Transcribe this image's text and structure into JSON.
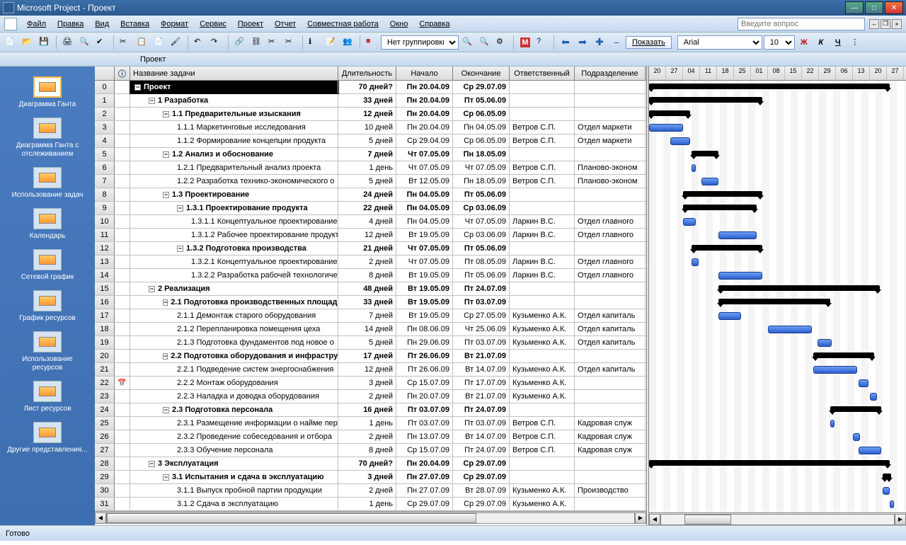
{
  "title": "Microsoft Project - Проект",
  "ask_placeholder": "Введите вопрос",
  "menu": [
    "Файл",
    "Правка",
    "Вид",
    "Вставка",
    "Формат",
    "Сервис",
    "Проект",
    "Отчет",
    "Совместная работа",
    "Окно",
    "Справка"
  ],
  "toolbar": {
    "grouping": "Нет группировки",
    "show_label": "Показать",
    "font": "Arial",
    "size": "10"
  },
  "doc_label": "Проект",
  "sidebar": [
    {
      "label": "Диаграмма Ганта",
      "active": true
    },
    {
      "label": "Диаграмма Ганта с отслеживанием"
    },
    {
      "label": "Использование задач"
    },
    {
      "label": "Календарь"
    },
    {
      "label": "Сетевой график"
    },
    {
      "label": "График ресурсов"
    },
    {
      "label": "Использование ресурсов"
    },
    {
      "label": "Лист ресурсов"
    },
    {
      "label": "Другие представления..."
    }
  ],
  "columns": {
    "info": "ⓘ",
    "name": "Название задачи",
    "dur": "Длительность",
    "start": "Начало",
    "end": "Окончание",
    "resp": "Ответственный",
    "dept": "Подразделение"
  },
  "timeline_days": [
    "20",
    "27",
    "04",
    "11",
    "18",
    "25",
    "01",
    "08",
    "15",
    "22",
    "29",
    "06",
    "13",
    "20",
    "27"
  ],
  "tasks": [
    {
      "row": 0,
      "lvl": 0,
      "exp": "-",
      "name": "Проект",
      "dur": "70 дней?",
      "start": "Пн 20.04.09",
      "end": "Ср 29.07.09",
      "resp": "",
      "dept": "",
      "sum": true,
      "gx": 0,
      "gw": 340,
      "selected": true
    },
    {
      "row": 1,
      "lvl": 1,
      "exp": "-",
      "name": "1 Разработка",
      "dur": "33 дней",
      "start": "Пн 20.04.09",
      "end": "Пт 05.06.09",
      "resp": "",
      "dept": "",
      "sum": true,
      "gx": 0,
      "gw": 160
    },
    {
      "row": 2,
      "lvl": 2,
      "exp": "-",
      "name": "1.1 Предварительные изыскания",
      "dur": "12 дней",
      "start": "Пн 20.04.09",
      "end": "Ср 06.05.09",
      "resp": "",
      "dept": "",
      "sum": true,
      "gx": 0,
      "gw": 58
    },
    {
      "row": 3,
      "lvl": 3,
      "leaf": true,
      "name": "1.1.1 Маркетинговые исследования",
      "dur": "10 дней",
      "start": "Пн 20.04.09",
      "end": "Пн 04.05.09",
      "resp": "Ветров С.П.",
      "dept": "Отдел маркети",
      "gx": 0,
      "gw": 48
    },
    {
      "row": 4,
      "lvl": 3,
      "leaf": true,
      "name": "1.1.2 Формирование концепции продукта",
      "dur": "5 дней",
      "start": "Ср 29.04.09",
      "end": "Ср 06.05.09",
      "resp": "Ветров С.П.",
      "dept": "Отдел маркети",
      "gx": 30,
      "gw": 28
    },
    {
      "row": 5,
      "lvl": 2,
      "exp": "-",
      "name": "1.2 Анализ и обоснование",
      "dur": "7 дней",
      "start": "Чт 07.05.09",
      "end": "Пн 18.05.09",
      "resp": "",
      "dept": "",
      "sum": true,
      "gx": 60,
      "gw": 38
    },
    {
      "row": 6,
      "lvl": 3,
      "leaf": true,
      "name": "1.2.1 Предварительный анализ проекта",
      "dur": "1 день",
      "start": "Чт 07.05.09",
      "end": "Чт 07.05.09",
      "resp": "Ветров С.П.",
      "dept": "Планово-эконом",
      "gx": 60,
      "gw": 6
    },
    {
      "row": 7,
      "lvl": 3,
      "leaf": true,
      "name": "1.2.2 Разработка технико-экономического о",
      "dur": "5 дней",
      "start": "Вт 12.05.09",
      "end": "Пн 18.05.09",
      "resp": "Ветров С.П.",
      "dept": "Планово-эконом",
      "gx": 74,
      "gw": 24
    },
    {
      "row": 8,
      "lvl": 2,
      "exp": "-",
      "name": "1.3 Проектирование",
      "dur": "24 дней",
      "start": "Пн 04.05.09",
      "end": "Пт 05.06.09",
      "resp": "",
      "dept": "",
      "sum": true,
      "gx": 48,
      "gw": 112
    },
    {
      "row": 9,
      "lvl": 3,
      "exp": "-",
      "name": "1.3.1 Проектирование продукта",
      "dur": "22 дней",
      "start": "Пн 04.05.09",
      "end": "Ср 03.06.09",
      "resp": "",
      "dept": "",
      "sum": true,
      "gx": 48,
      "gw": 104
    },
    {
      "row": 10,
      "lvl": 4,
      "leaf": true,
      "name": "1.3.1.1 Концептуальное проектирование",
      "dur": "4 дней",
      "start": "Пн 04.05.09",
      "end": "Чт 07.05.09",
      "resp": "Ларкин В.С.",
      "dept": "Отдел главного",
      "gx": 48,
      "gw": 18
    },
    {
      "row": 11,
      "lvl": 4,
      "leaf": true,
      "name": "1.3.1.2 Рабочее проектирование продукт",
      "dur": "12 дней",
      "start": "Вт 19.05.09",
      "end": "Ср 03.06.09",
      "resp": "Ларкин В.С.",
      "dept": "Отдел главного",
      "gx": 98,
      "gw": 54
    },
    {
      "row": 12,
      "lvl": 3,
      "exp": "-",
      "name": "1.3.2 Подготовка производства",
      "dur": "21 дней",
      "start": "Чт 07.05.09",
      "end": "Пт 05.06.09",
      "resp": "",
      "dept": "",
      "sum": true,
      "gx": 60,
      "gw": 100
    },
    {
      "row": 13,
      "lvl": 4,
      "leaf": true,
      "name": "1.3.2.1 Концептуальное проектирование",
      "dur": "2 дней",
      "start": "Чт 07.05.09",
      "end": "Пт 08.05.09",
      "resp": "Ларкин В.С.",
      "dept": "Отдел главного",
      "gx": 60,
      "gw": 10
    },
    {
      "row": 14,
      "lvl": 4,
      "leaf": true,
      "name": "1.3.2.2 Разработка рабочей технологиче",
      "dur": "8 дней",
      "start": "Вт 19.05.09",
      "end": "Пт 05.06.09",
      "resp": "Ларкин В.С.",
      "dept": "Отдел главного",
      "gx": 98,
      "gw": 62
    },
    {
      "row": 15,
      "lvl": 1,
      "exp": "-",
      "name": "2 Реализация",
      "dur": "48 дней",
      "start": "Вт 19.05.09",
      "end": "Пт 24.07.09",
      "resp": "",
      "dept": "",
      "sum": true,
      "gx": 98,
      "gw": 228
    },
    {
      "row": 16,
      "lvl": 2,
      "exp": "-",
      "name": "2.1 Подготовка производственных площад",
      "dur": "33 дней",
      "start": "Вт 19.05.09",
      "end": "Пт 03.07.09",
      "resp": "",
      "dept": "",
      "sum": true,
      "gx": 98,
      "gw": 158
    },
    {
      "row": 17,
      "lvl": 3,
      "leaf": true,
      "name": "2.1.1 Демонтаж старого оборудования",
      "dur": "7 дней",
      "start": "Вт 19.05.09",
      "end": "Ср 27.05.09",
      "resp": "Кузьменко А.К.",
      "dept": "Отдел капиталь",
      "gx": 98,
      "gw": 32
    },
    {
      "row": 18,
      "lvl": 3,
      "leaf": true,
      "name": "2.1.2 Перепланировка помещения цеха",
      "dur": "14 дней",
      "start": "Пн 08.06.09",
      "end": "Чт 25.06.09",
      "resp": "Кузьменко А.К.",
      "dept": "Отдел капиталь",
      "gx": 168,
      "gw": 62
    },
    {
      "row": 19,
      "lvl": 3,
      "leaf": true,
      "name": "2.1.3 Подготовка фундаментов под новое о",
      "dur": "5 дней",
      "start": "Пн 29.06.09",
      "end": "Пт 03.07.09",
      "resp": "Кузьменко А.К.",
      "dept": "Отдел капиталь",
      "gx": 238,
      "gw": 20
    },
    {
      "row": 20,
      "lvl": 2,
      "exp": "-",
      "name": "2.2 Подготовка оборудования и инфрастру",
      "dur": "17 дней",
      "start": "Пт 26.06.09",
      "end": "Вт 21.07.09",
      "resp": "",
      "dept": "",
      "sum": true,
      "gx": 232,
      "gw": 86
    },
    {
      "row": 21,
      "lvl": 3,
      "leaf": true,
      "name": "2.2.1 Подведение систем энергоснабжения",
      "dur": "12 дней",
      "start": "Пт 26.06.09",
      "end": "Вт 14.07.09",
      "resp": "Кузьменко А.К.",
      "dept": "Отдел капиталь",
      "gx": 232,
      "gw": 62
    },
    {
      "row": 22,
      "lvl": 3,
      "leaf": true,
      "name": "2.2.2 Монтаж оборудования",
      "dur": "3 дней",
      "start": "Ср 15.07.09",
      "end": "Пт 17.07.09",
      "resp": "Кузьменко А.К.",
      "dept": "",
      "gx": 296,
      "gw": 14,
      "icon": true
    },
    {
      "row": 23,
      "lvl": 3,
      "leaf": true,
      "name": "2.2.3 Наладка и доводка оборудования",
      "dur": "2 дней",
      "start": "Пн 20.07.09",
      "end": "Вт 21.07.09",
      "resp": "Кузьменко А.К.",
      "dept": "",
      "gx": 312,
      "gw": 10
    },
    {
      "row": 24,
      "lvl": 2,
      "exp": "-",
      "name": "2.3 Подготовка персонала",
      "dur": "16 дней",
      "start": "Пт 03.07.09",
      "end": "Пт 24.07.09",
      "resp": "",
      "dept": "",
      "sum": true,
      "gx": 256,
      "gw": 72
    },
    {
      "row": 25,
      "lvl": 3,
      "leaf": true,
      "name": "2.3.1 Размещение информации о найме пер",
      "dur": "1 день",
      "start": "Пт 03.07.09",
      "end": "Пт 03.07.09",
      "resp": "Ветров С.П.",
      "dept": "Кадровая служ",
      "gx": 256,
      "gw": 6
    },
    {
      "row": 26,
      "lvl": 3,
      "leaf": true,
      "name": "2.3.2 Проведение собеседования и отбора",
      "dur": "2 дней",
      "start": "Пн 13.07.09",
      "end": "Вт 14.07.09",
      "resp": "Ветров С.П.",
      "dept": "Кадровая служ",
      "gx": 288,
      "gw": 10
    },
    {
      "row": 27,
      "lvl": 3,
      "leaf": true,
      "name": "2.3.3 Обучение персонала",
      "dur": "8 дней",
      "start": "Ср 15.07.09",
      "end": "Пт 24.07.09",
      "resp": "Ветров С.П.",
      "dept": "Кадровая служ",
      "gx": 296,
      "gw": 32
    },
    {
      "row": 28,
      "lvl": 1,
      "exp": "-",
      "name": "3 Эксплуатация",
      "dur": "70 дней?",
      "start": "Пн 20.04.09",
      "end": "Ср 29.07.09",
      "resp": "",
      "dept": "",
      "sum": true,
      "gx": 0,
      "gw": 340
    },
    {
      "row": 29,
      "lvl": 2,
      "exp": "-",
      "name": "3.1 Испытания и сдача в эксплуатацию",
      "dur": "3 дней",
      "start": "Пн 27.07.09",
      "end": "Ср 29.07.09",
      "resp": "",
      "dept": "",
      "sum": true,
      "gx": 330,
      "gw": 12
    },
    {
      "row": 30,
      "lvl": 3,
      "leaf": true,
      "name": "3.1.1 Выпуск пробной партии продукции",
      "dur": "2 дней",
      "start": "Пн 27.07.09",
      "end": "Вт 28.07.09",
      "resp": "Кузьменко А.К.",
      "dept": "Производство",
      "gx": 330,
      "gw": 10
    },
    {
      "row": 31,
      "lvl": 3,
      "leaf": true,
      "name": "3.1.2 Сдача в эксплуатацию",
      "dur": "1 день",
      "start": "Ср 29.07.09",
      "end": "Ср 29.07.09",
      "resp": "Кузьменко А.К.",
      "dept": "",
      "gx": 340,
      "gw": 6
    }
  ],
  "status": "Готово"
}
